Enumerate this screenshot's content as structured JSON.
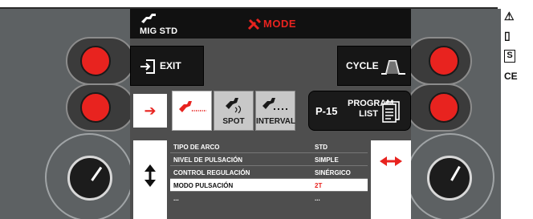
{
  "header": {
    "process": "MIG STD",
    "mode_label": "MODE"
  },
  "buttons": {
    "exit_label": "EXIT",
    "cycle_label": "CYCLE",
    "program_number": "P-15",
    "program_list_line1": "PROGRAM",
    "program_list_line2": "LIST"
  },
  "mode_tiles": [
    {
      "label": "",
      "selected": true
    },
    {
      "label": "SPOT",
      "selected": false
    },
    {
      "label": "INTERVAL",
      "selected": false
    }
  ],
  "parameters": [
    {
      "name": "TIPO DE ARCO",
      "value": "STD"
    },
    {
      "name": "NIVEL DE PULSACIÓN",
      "value": "SIMPLE"
    },
    {
      "name": "CONTROL REGULACIÓN",
      "value": "SINÉRGICO"
    },
    {
      "name": "MODO PULSACIÓN",
      "value": "2T"
    },
    {
      "name": "...",
      "value": "..."
    }
  ],
  "active_parameter_index": 3,
  "side_symbols": [
    "⚠",
    "▯",
    "S",
    "CE"
  ],
  "colors": {
    "accent_red": "#e8231f",
    "panel_gray": "#5d6163",
    "screen_dark": "#111111"
  },
  "icons": [
    "torch-icon",
    "tools-icon",
    "exit-door-icon",
    "cycle-wave-icon",
    "document-list-icon",
    "arrow-right-icon",
    "arrow-updown-icon",
    "arrow-leftright-icon"
  ]
}
